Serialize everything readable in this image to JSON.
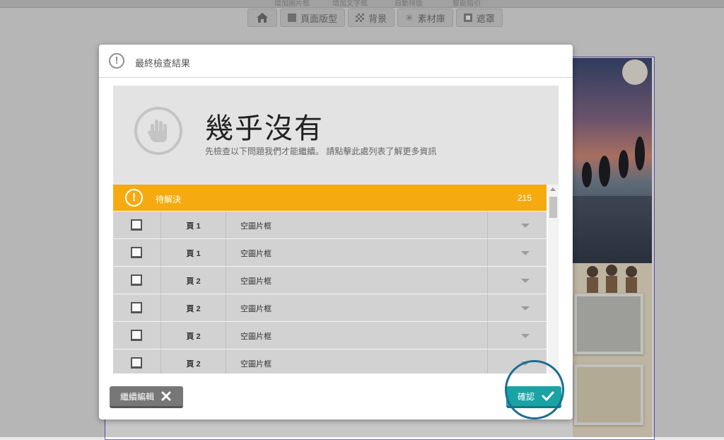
{
  "toolbar": {
    "top_items": [
      "增加圖片框",
      "增加文字框",
      "自動排版",
      "智能指引"
    ],
    "tabs": [
      {
        "label": "",
        "icon": "home-icon"
      },
      {
        "label": "頁面版型",
        "icon": "layout-icon"
      },
      {
        "label": "背景",
        "icon": "background-icon"
      },
      {
        "label": "素材庫",
        "icon": "sparkle-icon"
      },
      {
        "label": "遮罩",
        "icon": "mask-icon"
      }
    ]
  },
  "dialog": {
    "title": "最終檢查結果",
    "summary_heading": "幾乎沒有",
    "summary_desc": "先檢查以下問題我們才能繼續。 請點擊此處列表了解更多資訊",
    "pending": {
      "label": "待解決",
      "count": "215"
    },
    "issues": [
      {
        "page": "頁 1",
        "issue": "空圖片框"
      },
      {
        "page": "頁 1",
        "issue": "空圖片框"
      },
      {
        "page": "頁 2",
        "issue": "空圖片框"
      },
      {
        "page": "頁 2",
        "issue": "空圖片框"
      },
      {
        "page": "頁 2",
        "issue": "空圖片框"
      },
      {
        "page": "頁 2",
        "issue": "空圖片框"
      }
    ],
    "continue_label": "繼續編輯",
    "confirm_label": "確認"
  },
  "colors": {
    "accent": "#f5ab10",
    "confirm": "#1aa3a5",
    "ring": "#1c6e93"
  }
}
